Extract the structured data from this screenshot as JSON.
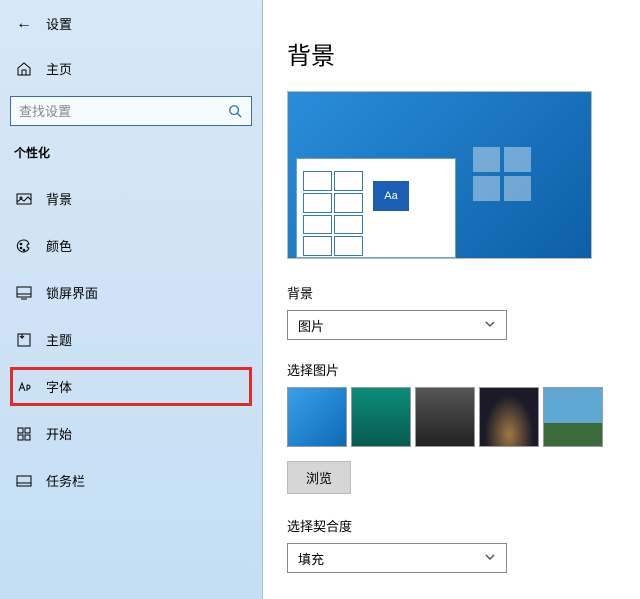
{
  "header": {
    "title": "设置"
  },
  "home": {
    "label": "主页"
  },
  "search": {
    "placeholder": "查找设置"
  },
  "category": "个性化",
  "nav": {
    "background": "背景",
    "color": "颜色",
    "lockscreen": "锁屏界面",
    "themes": "主题",
    "fonts": "字体",
    "start": "开始",
    "taskbar": "任务栏"
  },
  "main": {
    "title": "背景",
    "preview_accent_text": "Aa",
    "background_label": "背景",
    "background_value": "图片",
    "choose_picture_label": "选择图片",
    "browse_label": "浏览",
    "fit_label": "选择契合度",
    "fit_value": "填充"
  }
}
